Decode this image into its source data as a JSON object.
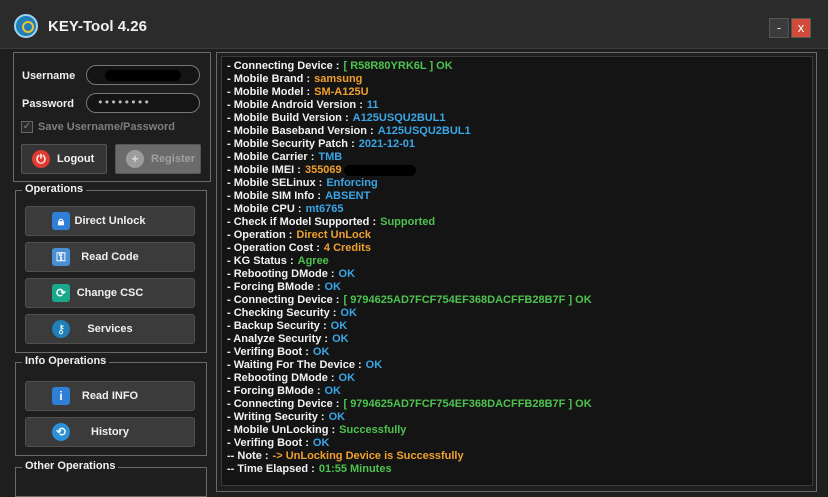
{
  "window": {
    "title": "KEY-Tool 4.26",
    "minimize_glyph": "-",
    "close_glyph": "x"
  },
  "login": {
    "username_label": "Username",
    "username_value": "",
    "password_label": "Password",
    "password_value": "••••••••",
    "save_label": "Save Username/Password",
    "save_checked": true,
    "logout_label": "Logout",
    "register_label": "Register"
  },
  "operations": {
    "title": "Operations",
    "buttons": [
      {
        "label": "Direct Unlock",
        "icon": "lock-icon",
        "color": "#2f7fd6"
      },
      {
        "label": "Read Code",
        "icon": "key-code-icon",
        "color": "#4a8fd6"
      },
      {
        "label": "Change CSC",
        "icon": "csc-icon",
        "color": "#1aa88a"
      },
      {
        "label": "Services",
        "icon": "key-logo-icon",
        "color": "#1f7fb6"
      }
    ]
  },
  "info_operations": {
    "title": "Info Operations",
    "buttons": [
      {
        "label": "Read INFO",
        "icon": "info-icon",
        "color": "#2f7fd6"
      },
      {
        "label": "History",
        "icon": "history-icon",
        "color": "#2d8fd6"
      }
    ]
  },
  "other_operations": {
    "title": "Other Operations"
  },
  "colors": {
    "ok": "#4ec24e",
    "orange": "#f0a030",
    "blue": "#3aa6e6"
  },
  "log": [
    {
      "label": "- Connecting Device :",
      "value": "[ R58R80YRK6L ] OK",
      "color": "ok"
    },
    {
      "label": "- Mobile Brand :",
      "value": "samsung",
      "color": "orange"
    },
    {
      "label": "- Mobile Model :",
      "value": "SM-A125U",
      "color": "orange"
    },
    {
      "label": "- Mobile Android Version :",
      "value": "11",
      "color": "blue"
    },
    {
      "label": "- Mobile Build Version :",
      "value": "A125USQU2BUL1",
      "color": "blue"
    },
    {
      "label": "- Mobile Baseband Version :",
      "value": "A125USQU2BUL1",
      "color": "blue"
    },
    {
      "label": "- Mobile Security Patch :",
      "value": "2021-12-01",
      "color": "blue"
    },
    {
      "label": "- Mobile Carrier :",
      "value": "TMB",
      "color": "blue"
    },
    {
      "label": "- Mobile IMEI :",
      "value": "355069",
      "color": "orange",
      "redacted": true
    },
    {
      "label": "- Mobile SELinux :",
      "value": "Enforcing",
      "color": "blue"
    },
    {
      "label": "- Mobile SIM Info :",
      "value": "ABSENT",
      "color": "blue"
    },
    {
      "label": "- Mobile CPU :",
      "value": "mt6765",
      "color": "blue"
    },
    {
      "label": "- Check if Model Supported :",
      "value": "Supported",
      "color": "ok"
    },
    {
      "label": "- Operation :",
      "value": "Direct UnLock",
      "color": "orange"
    },
    {
      "label": "- Operation Cost :",
      "value": "4 Credits",
      "color": "orange"
    },
    {
      "label": "- KG Status :",
      "value": "Agree",
      "color": "ok"
    },
    {
      "label": "- Rebooting DMode :",
      "value": "OK",
      "color": "blue"
    },
    {
      "label": "- Forcing BMode :",
      "value": "OK",
      "color": "blue"
    },
    {
      "label": "- Connecting Device :",
      "value": "[ 9794625AD7FCF754EF368DACFFB28B7F ] OK",
      "color": "ok"
    },
    {
      "label": "- Checking Security :",
      "value": "OK",
      "color": "blue"
    },
    {
      "label": "- Backup Security :",
      "value": "OK",
      "color": "blue"
    },
    {
      "label": "- Analyze Security :",
      "value": "OK",
      "color": "blue"
    },
    {
      "label": "- Verifing Boot :",
      "value": "OK",
      "color": "blue"
    },
    {
      "label": "- Waiting For The Device :",
      "value": "OK",
      "color": "blue"
    },
    {
      "label": "- Rebooting DMode :",
      "value": "OK",
      "color": "blue"
    },
    {
      "label": "- Forcing BMode :",
      "value": "OK",
      "color": "blue"
    },
    {
      "label": "- Connecting Device :",
      "value": "[ 9794625AD7FCF754EF368DACFFB28B7F ] OK",
      "color": "ok"
    },
    {
      "label": "- Writing Security :",
      "value": "OK",
      "color": "blue"
    },
    {
      "label": "- Mobile UnLocking :",
      "value": "Successfully",
      "color": "ok"
    },
    {
      "label": "- Verifing Boot :",
      "value": "OK",
      "color": "blue"
    },
    {
      "label": "-- Note :",
      "value": "-> UnLocking Device is Successfully",
      "color": "orange"
    },
    {
      "label": "-- Time Elapsed :",
      "value": "01:55 Minutes",
      "color": "ok"
    }
  ]
}
